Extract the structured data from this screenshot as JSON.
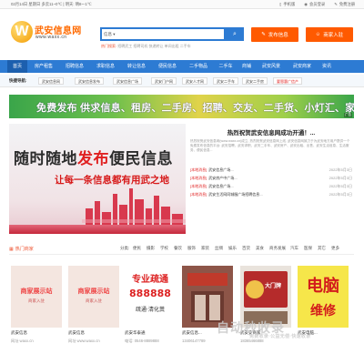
{
  "topbar": {
    "date": "02月14日 星期日",
    "weather": "多云11~0℃ | 明天:",
    "weather2": "晴8~-1℃",
    "links": [
      "手机版",
      "会员登录",
      "免费注册"
    ]
  },
  "logo": {
    "letter": "W",
    "name": "武安信息网",
    "url": "www.waxx.cn"
  },
  "search": {
    "category": "信息",
    "button_icon": "search-icon",
    "hot_label": "热门搜索:",
    "hot_items": "招聘武工 招聘司机 快递转让 单间出租 二手车"
  },
  "actions": {
    "post": "发布信息",
    "merchant": "商家入驻"
  },
  "nav": [
    "首页",
    "房产租售",
    "招聘信息",
    "求职信息",
    "转让信息",
    "便民信息",
    "二手物品",
    "二手车",
    "商铺",
    "武安风景",
    "武安商家",
    "资讯"
  ],
  "quick": {
    "label": "快捷导航:",
    "items": [
      "武安信息网",
      "武安信息发布",
      "武安信息广场",
      "武安门户网",
      "武安人才网",
      "武安二手车",
      "武安二手房",
      "要恩惠广信产"
    ]
  },
  "banner": {
    "text": "免费发布 供求信息、租房、二手房、招聘、交友、二手货、小灯汇、家政 等生活分类信息",
    "tag": "广告"
  },
  "slide": {
    "headline_a": "随时随地",
    "headline_b": "发布",
    "headline_c": "便民信息",
    "subline": "让每一条信息都有用武之地"
  },
  "news": {
    "title": "热烈祝贺武安信息网成功开通！...",
    "desc": "热烈祝贺武安信息网(www.waxx.cn)成立, 热烈祝贺武安信息网上线, 武安信息网致力于为武安地方用户提供一个免费发布信息的平台: 武安招聘、武安求职、武安二手车、武安房产、武安出租、出售、武安生活信息、生活服务、便民信息...",
    "rows": [
      {
        "cat": "[本地消息]",
        "text": "武安信息广场...",
        "date": "2022年5月3日"
      },
      {
        "cat": "[本地消息]",
        "text": "武安房产中广场...",
        "date": "2022年5月3日"
      },
      {
        "cat": "[本地消息]",
        "text": "武安信息广场...",
        "date": "2022年5月3日"
      },
      {
        "cat": "[本地消息]",
        "text": "武安生活网同城服广场招聘信息...",
        "date": "2022年5月3日"
      }
    ]
  },
  "categories": {
    "title": "热门商家",
    "label": "分类:",
    "items": [
      "便民",
      "摄影",
      "学校",
      "餐饮",
      "服饰",
      "家装",
      "丝绸",
      "娱乐",
      "百货",
      "美食",
      "商务发展",
      "汽车",
      "医保",
      "其它",
      "更多"
    ]
  },
  "cards": [
    {
      "name": "武安信息",
      "sub": "网址 waxx.cn",
      "img": "商家展示站"
    },
    {
      "name": "武安信息",
      "sub": "网址 www.waxx.cn",
      "img": "商家展示站"
    },
    {
      "name": "武安华泰通",
      "sub": "电话: 0546-8889888",
      "img": "专业疏通"
    },
    {
      "name": "武安信息...",
      "sub": "13406147789",
      "img": "店铺"
    },
    {
      "name": "武安安商家",
      "sub": "18365466888",
      "img": "大门牌"
    },
    {
      "name": "武安电脑...",
      "sub": "",
      "img": "电脑维修"
    }
  ],
  "watermark": {
    "text": "自动秒收录",
    "sub": "免费收录·公益无偿·快速收录"
  },
  "colors": {
    "brand_blue": "#2d7bd3",
    "accent_orange": "#ff5a00",
    "highlight_red": "#e02020"
  }
}
